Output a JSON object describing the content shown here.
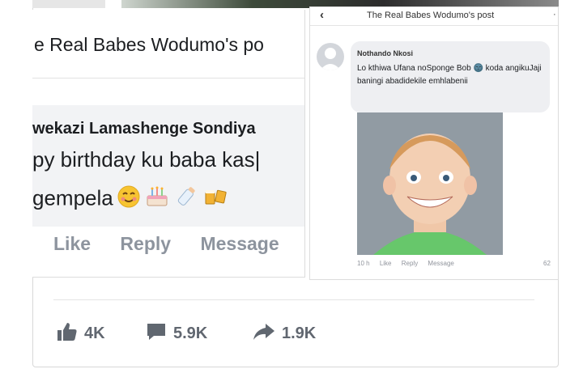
{
  "left_crop": {
    "title": "e Real Babes Wodumo's po",
    "commenter": "wekazi Lamashenge Sondiya",
    "line1": "py birthday ku baba kas|",
    "line2": "gempela",
    "actions": [
      "Like",
      "Reply",
      "Message"
    ]
  },
  "right_screenshot": {
    "back_icon": "chevron-left-icon",
    "header_title": "The Real Babes Wodumo's post",
    "commenter": "Nothando Nkosi",
    "comment_text": "Lo kthiwa Ufana noSponge Bob 🌚 koda angikuJaji baningi abadidekile emhlabenii",
    "meta": {
      "time": "10 h",
      "like": "Like",
      "reply": "Reply",
      "message": "Message",
      "reactions": "62"
    }
  },
  "footer": {
    "likes": "4K",
    "comments": "5.9K",
    "shares": "1.9K",
    "icon_color": "#606770"
  }
}
